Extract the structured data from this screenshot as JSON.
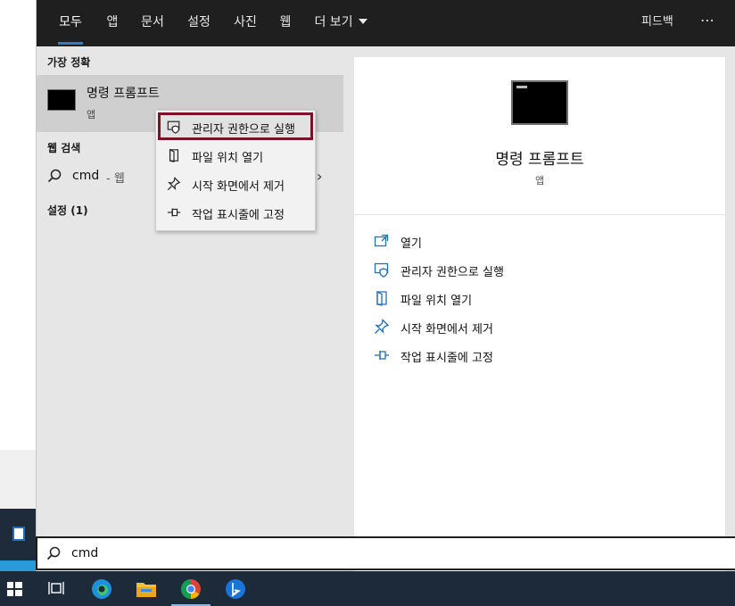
{
  "topnav": {
    "tabs": [
      {
        "label": "모두",
        "active": true
      },
      {
        "label": "앱"
      },
      {
        "label": "문서"
      },
      {
        "label": "설정"
      },
      {
        "label": "사진"
      },
      {
        "label": "웹"
      },
      {
        "label": "더 보기"
      }
    ],
    "feedback": "피드백",
    "more": "⋯"
  },
  "results": {
    "best_match_heading": "가장 정확",
    "best_match": {
      "name": "명령 프롬프트",
      "type": "앱"
    },
    "web_heading": "웹 검색",
    "web_query": "cmd",
    "web_suffix": "- 웹",
    "settings_heading": "설정 (1)"
  },
  "context_menu": {
    "items": [
      {
        "label": "관리자 권한으로 실행",
        "icon": "shield-icon",
        "highlighted": true
      },
      {
        "label": "파일 위치 열기",
        "icon": "folder-icon"
      },
      {
        "label": "시작 화면에서 제거",
        "icon": "unpin-icon"
      },
      {
        "label": "작업 표시줄에 고정",
        "icon": "pin-icon"
      }
    ]
  },
  "detail": {
    "title": "명령 프롬프트",
    "subtitle": "앱",
    "actions": [
      {
        "label": "열기",
        "icon": "open-icon"
      },
      {
        "label": "관리자 권한으로 실행",
        "icon": "shield-icon"
      },
      {
        "label": "파일 위치 열기",
        "icon": "folder-icon"
      },
      {
        "label": "시작 화면에서 제거",
        "icon": "unpin-icon"
      },
      {
        "label": "작업 표시줄에 고정",
        "icon": "pin-icon"
      }
    ]
  },
  "search": {
    "value": "cmd"
  },
  "taskbar": {
    "items": [
      "windows-start-icon",
      "task-view-icon",
      "edge-icon",
      "file-explorer-icon",
      "chrome-icon",
      "bing-icon"
    ],
    "active": "chrome-icon"
  },
  "colors": {
    "accent": "#2b7cd3",
    "highlight_border": "#7b1225",
    "nav_bg": "#1f1f1f",
    "taskbar_bg": "#1c2a3a"
  }
}
